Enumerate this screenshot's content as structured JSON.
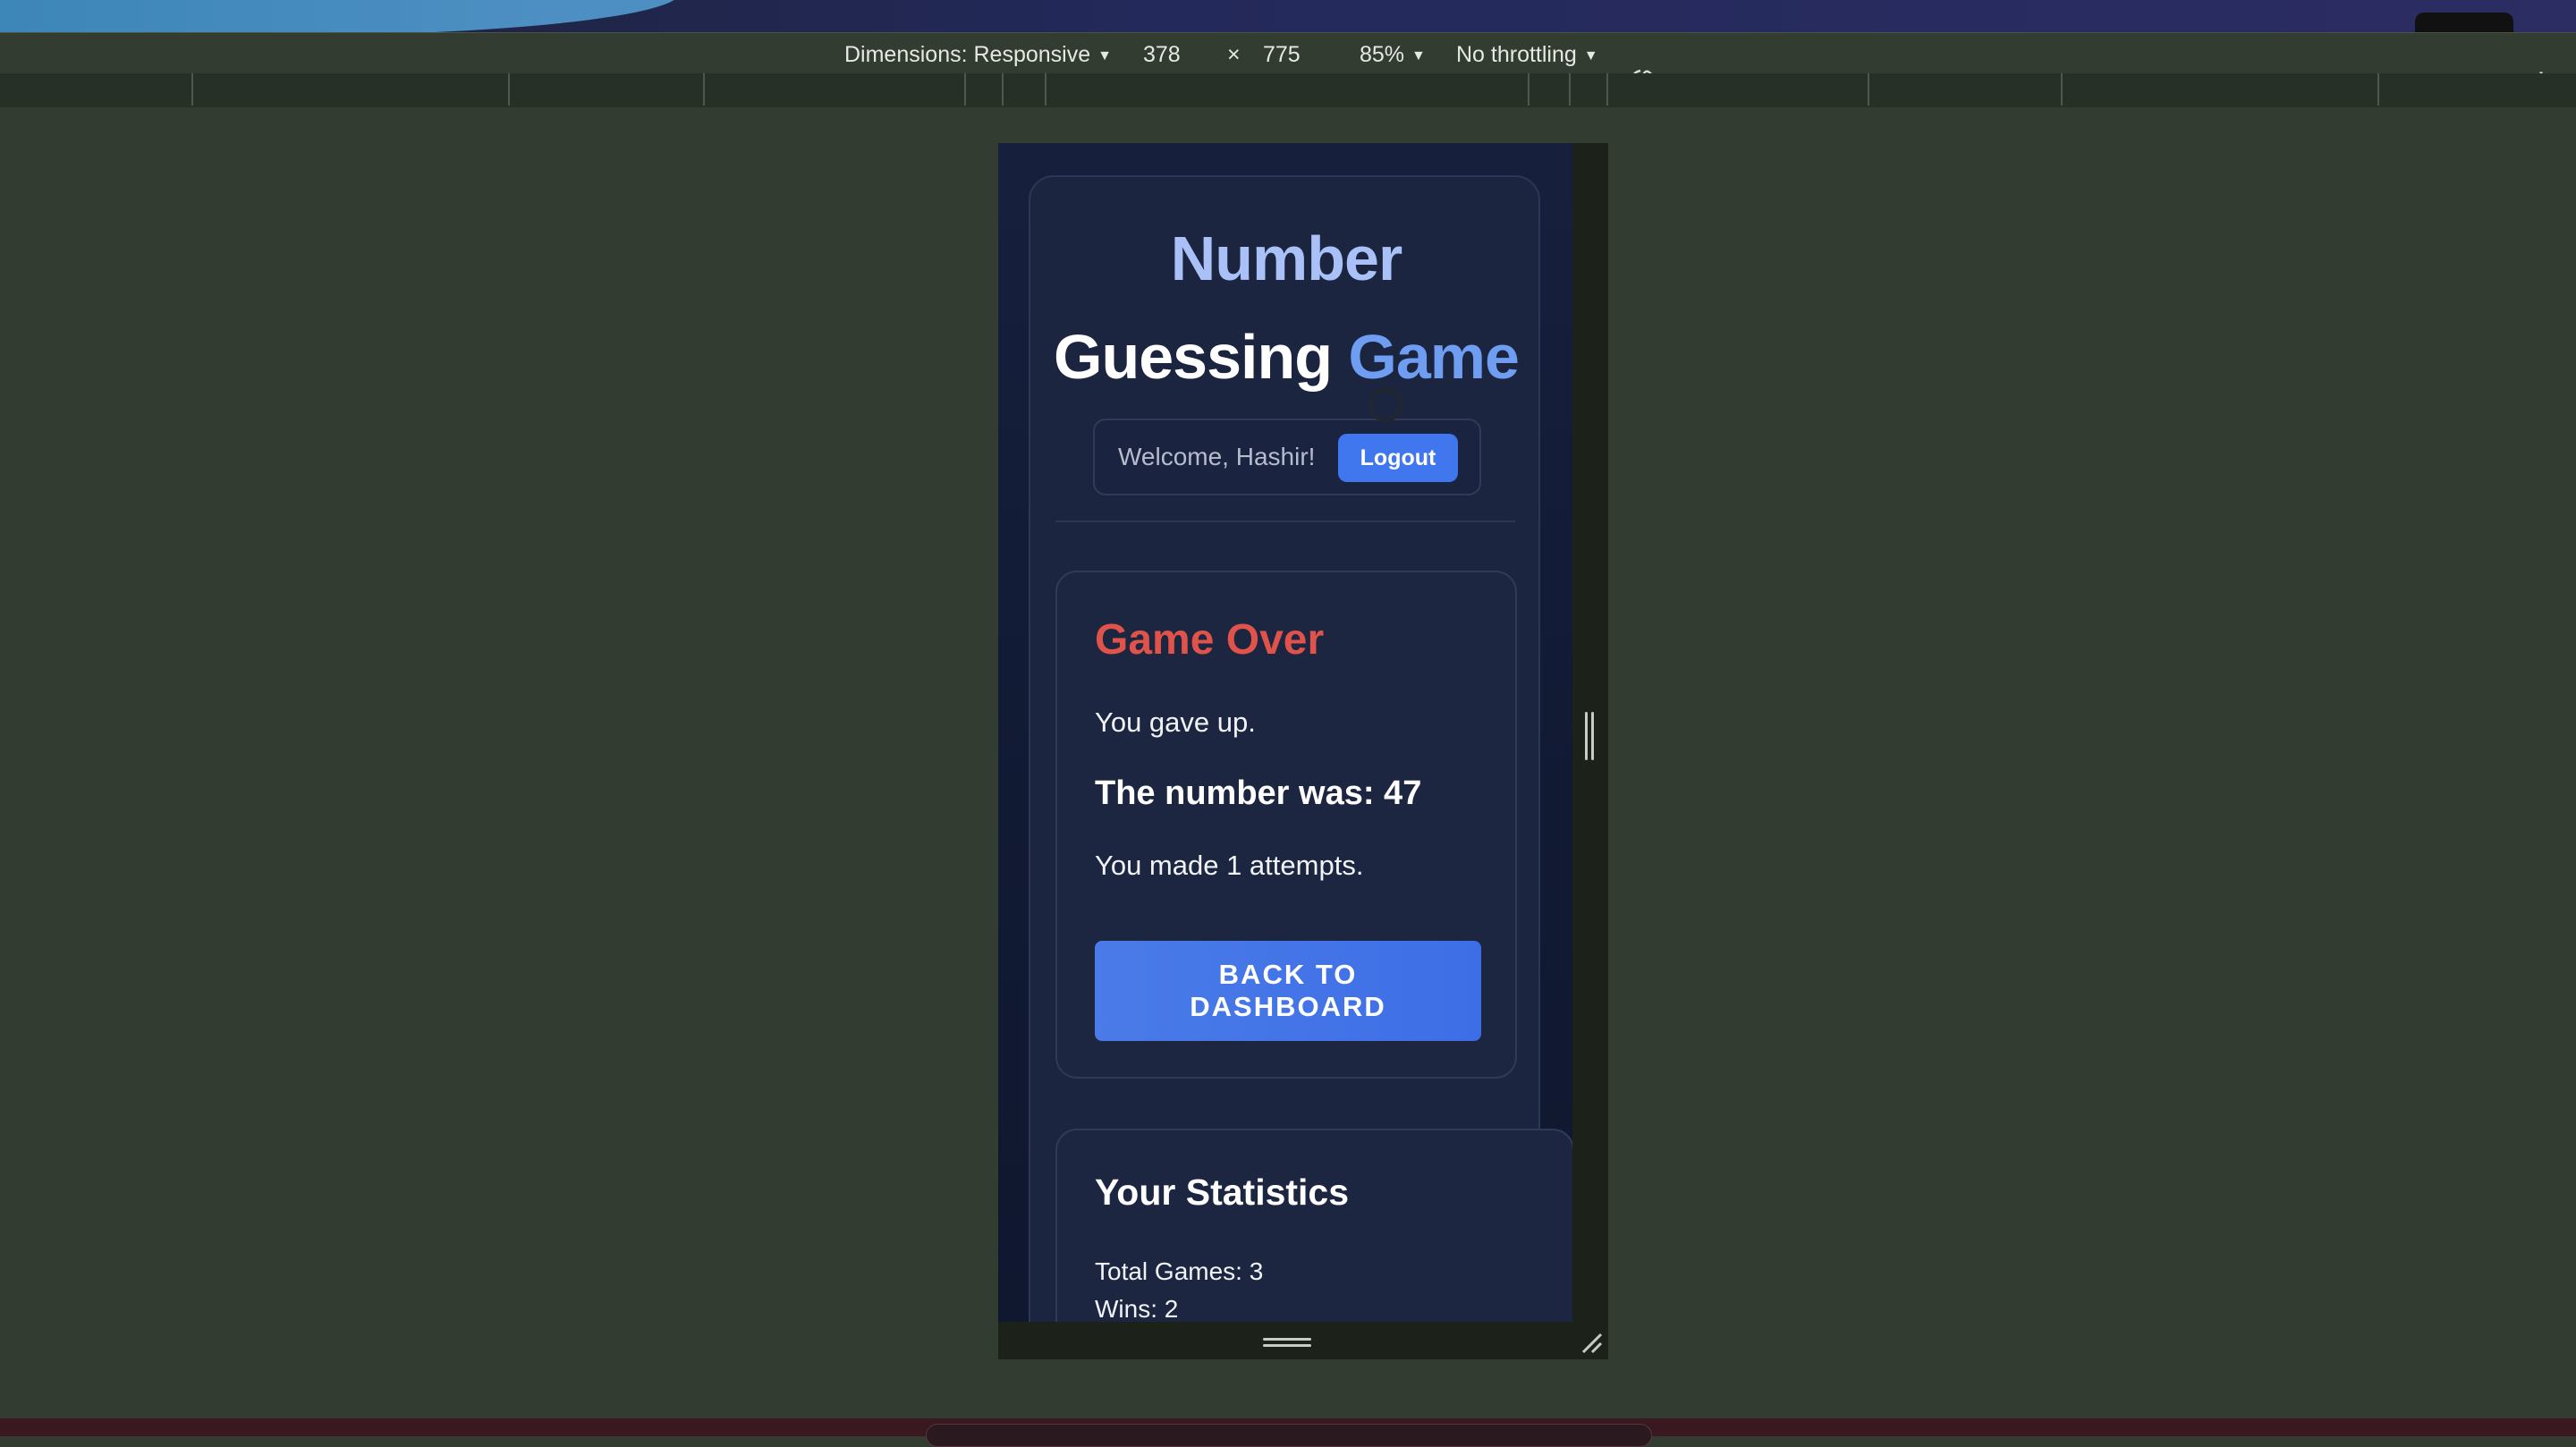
{
  "devtools": {
    "dimensions_label": "Dimensions: Responsive",
    "width": "378",
    "times": "×",
    "height": "775",
    "zoom": "85%",
    "throttling": "No throttling"
  },
  "app": {
    "title_word1": "Number",
    "title_word2": "Guessing",
    "title_word3": "Game",
    "welcome": "Welcome, Hashir!",
    "logout_label": "Logout"
  },
  "game_over": {
    "heading": "Game Over",
    "gave_up": "You gave up.",
    "number_text": "The number was: 47",
    "attempts_text": "You made 1 attempts.",
    "back_button": "BACK TO DASHBOARD"
  },
  "statistics": {
    "heading": "Your Statistics",
    "total_games": "Total Games: 3",
    "wins": "Wins: 2"
  },
  "colors": {
    "accent": "#4077ef",
    "danger": "#e0534a",
    "page_bg": "#323c31",
    "app_bg": "#111a33"
  }
}
